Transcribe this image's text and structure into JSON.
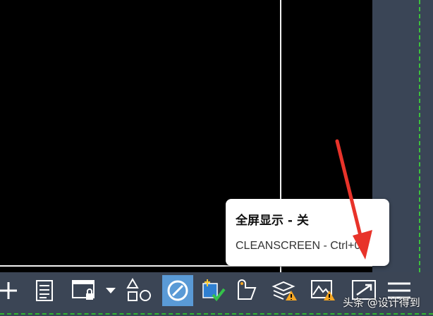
{
  "tooltip": {
    "title": "全屏显示 - 关",
    "command": "CLEANSCREEN - Ctrl+0"
  },
  "watermark": "头条 @设计得到",
  "statusbar": {
    "buttons": [
      {
        "name": "add-icon"
      },
      {
        "name": "properties-icon"
      },
      {
        "name": "display-lock-icon"
      },
      {
        "name": "dropdown-arrow-icon"
      },
      {
        "name": "shapes-icon"
      },
      {
        "name": "isolate-objects-icon"
      },
      {
        "name": "annotation-scale-icon"
      },
      {
        "name": "clean-icon"
      },
      {
        "name": "layers-warning-icon"
      },
      {
        "name": "hardware-warning-icon"
      },
      {
        "name": "clean-screen-icon"
      },
      {
        "name": "customization-menu-icon"
      }
    ]
  },
  "colors": {
    "canvas": "#000000",
    "panel": "#3a4556",
    "accent": "#5a9ad6",
    "green": "#3dbf3d",
    "arrow": "#e8332a"
  }
}
